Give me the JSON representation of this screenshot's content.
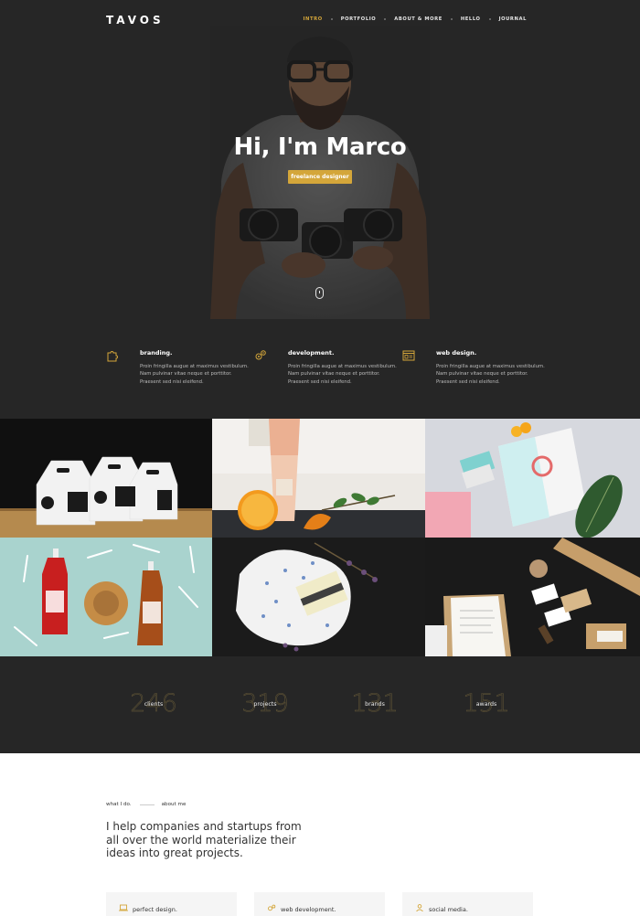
{
  "nav": {
    "logo": "TAVOS",
    "items": [
      {
        "label": "INTRO",
        "active": true
      },
      {
        "label": "PORTFOLIO",
        "active": false
      },
      {
        "label": "ABOUT & MORE",
        "active": false
      },
      {
        "label": "HELLO",
        "active": false
      },
      {
        "label": "JOURNAL",
        "active": false
      }
    ]
  },
  "hero": {
    "title": "Hi, I'm Marco",
    "badge": "freelance designer",
    "scroll_icon": "mouse-icon"
  },
  "services": [
    {
      "icon": "puzzle-icon",
      "title": "branding.",
      "text": "Proin fringilla augue at maximus vestibulum. Nam pulvinar vitae neque et porttitor. Praesent sed nisi eleifend."
    },
    {
      "icon": "gears-icon",
      "title": "development.",
      "text": "Proin fringilla augue at maximus vestibulum. Nam pulvinar vitae neque et porttitor. Praesent sed nisi eleifend."
    },
    {
      "icon": "browser-icon",
      "title": "web design.",
      "text": "Proin fringilla augue at maximus vestibulum. Nam pulvinar vitae neque et porttitor. Praesent sed nisi eleifend."
    }
  ],
  "portfolio": [
    {
      "name": "packaging-boxes"
    },
    {
      "name": "bottle-orange"
    },
    {
      "name": "stationery-leaf"
    },
    {
      "name": "sauce-bottles"
    },
    {
      "name": "soap-wrap"
    },
    {
      "name": "kraft-stationery"
    }
  ],
  "stats": [
    {
      "number": "246",
      "label": "clients"
    },
    {
      "number": "319",
      "label": "projects"
    },
    {
      "number": "131",
      "label": "brands"
    },
    {
      "number": "151",
      "label": "awards"
    }
  ],
  "about": {
    "tabs": [
      {
        "label": "what I do.",
        "active": true
      },
      {
        "label": "about me",
        "active": false
      }
    ],
    "text": "I help companies and startups from all over the world materialize their ideas into great projects.",
    "features": [
      {
        "icon": "laptop-icon",
        "label": "perfect design."
      },
      {
        "icon": "gears-icon",
        "label": "web development."
      },
      {
        "icon": "user-icon",
        "label": "social media."
      }
    ]
  },
  "colors": {
    "accent": "#d4a63a",
    "dark": "#262626"
  }
}
